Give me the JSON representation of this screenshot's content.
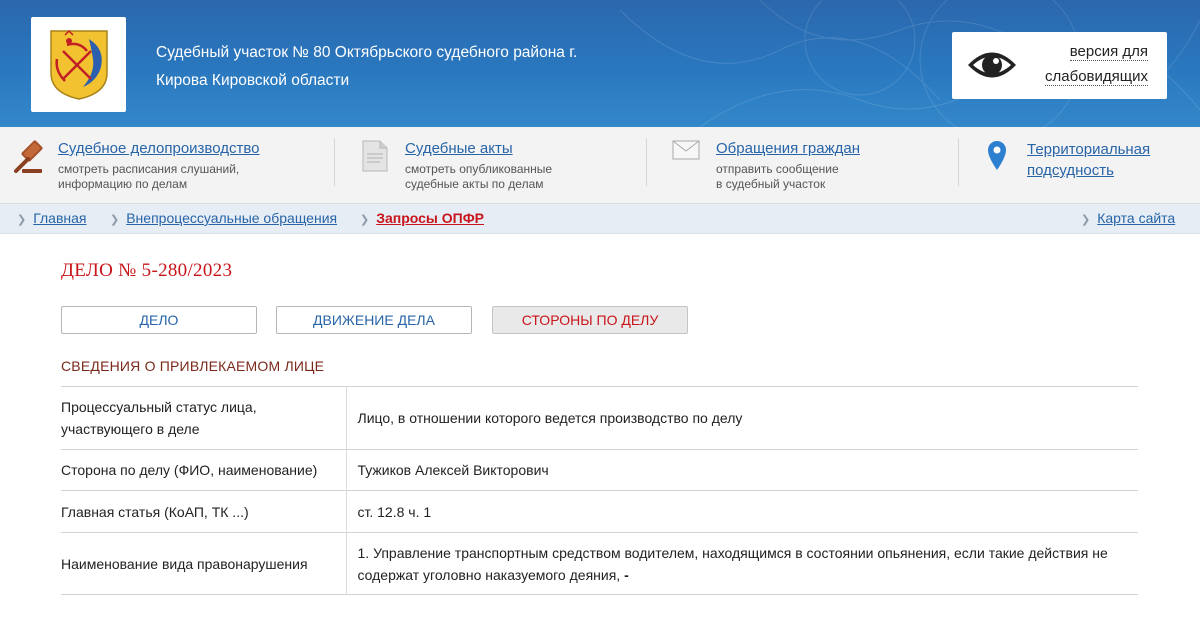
{
  "header": {
    "court_title_line1": "Судебный участок № 80 Октябрьского судебного района г.",
    "court_title_line2": "Кирова Кировской области",
    "emblem_icon": "kirov-oblast-coat-of-arms",
    "vision_icon": "eye-icon",
    "vision_line1": "версия для",
    "vision_line2": "слабовидящих"
  },
  "nav": [
    {
      "icon": "gavel-icon",
      "title": "Судебное делопроизводство",
      "sub1": "смотреть расписания слушаний,",
      "sub2": "информацию по делам"
    },
    {
      "icon": "document-icon",
      "title": "Судебные акты",
      "sub1": "смотреть опубликованные",
      "sub2": "судебные акты по делам"
    },
    {
      "icon": "envelope-icon",
      "title": "Обращения граждан",
      "sub1": "отправить сообщение",
      "sub2": "в судебный участок"
    },
    {
      "icon": "map-pin-icon",
      "title1": "Территориальная",
      "title2": "подсудность"
    }
  ],
  "breadcrumbs": {
    "home": "Главная",
    "section": "Внепроцессуальные обращения",
    "current": "Запросы ОПФР",
    "sitemap": "Карта сайта"
  },
  "case": {
    "title": "ДЕЛО № 5-280/2023",
    "tabs": [
      "ДЕЛО",
      "ДВИЖЕНИЕ ДЕЛА",
      "СТОРОНЫ ПО ДЕЛУ"
    ],
    "active_tab": "СТОРОНЫ ПО ДЕЛУ",
    "section_title": "СВЕДЕНИЯ О ПРИВЛЕКАЕМОМ ЛИЦЕ",
    "rows": [
      {
        "key1": "Процессуальный статус лица,",
        "key2": "участвующего в деле",
        "value": "Лицо, в отношении которого ведется производство по делу"
      },
      {
        "key": "Сторона по делу (ФИО, наименование)",
        "value": "Тужиков Алексей Викторович"
      },
      {
        "key": "Главная статья (КоАП, ТК ...)",
        "value": "ст. 12.8 ч. 1"
      },
      {
        "key": "Наименование вида правонарушения",
        "value1": "1. Управление транспортным средством водителем, находящимся в состоянии опьянения, если такие действия не",
        "value2": "содержат уголовно наказуемого деяния,",
        "value2_suffix": "-"
      }
    ]
  },
  "colors": {
    "header_blue": "#2a78bf",
    "link_blue": "#2764a8",
    "accent_red": "#c8151b",
    "section_brown": "#7a2a1b"
  }
}
